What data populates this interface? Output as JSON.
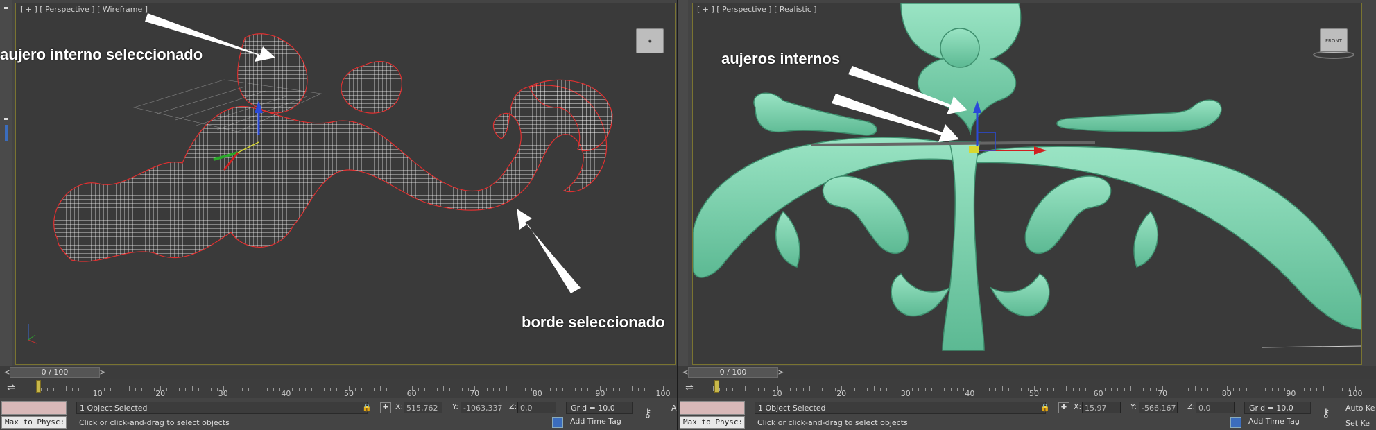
{
  "left": {
    "viewport_label": "[ + ] [ Perspective ] [ Wireframe ]",
    "annotations": {
      "top": "aujero interno seleccionado",
      "bottom": "borde seleccionado"
    },
    "scroll_thumb": "0 / 100",
    "timeline_labels": [
      "10",
      "20",
      "30",
      "40",
      "50",
      "60",
      "70",
      "80",
      "90",
      "100"
    ],
    "selected": "1 Object Selected",
    "prompt": "Click or click-and-drag to select objects",
    "x_label": "X:",
    "x": "515,762",
    "y_label": "Y:",
    "y": "-1063,337",
    "z_label": "Z:",
    "z": "0,0",
    "grid": "Grid = 10,0",
    "add_time_tag": "Add Time Tag",
    "maxscript": "Max to Physc:",
    "side_letter": "A"
  },
  "right": {
    "viewport_label": "[ + ] [ Perspective ] [ Realistic ]",
    "annotations": {
      "top": "aujeros internos"
    },
    "viewcube_label": "FRONT",
    "scroll_thumb": "0 / 100",
    "timeline_labels": [
      "10",
      "20",
      "30",
      "40",
      "50",
      "60",
      "70",
      "80",
      "90",
      "100"
    ],
    "selected": "1 Object Selected",
    "prompt": "Click or click-and-drag to select objects",
    "x_label": "X:",
    "x": "15,97",
    "y_label": "Y:",
    "y": "-566,167",
    "z_label": "Z:",
    "z": "0,0",
    "grid": "Grid = 10,0",
    "add_time_tag": "Add Time Tag",
    "maxscript": "Max to Physc:",
    "auto_key": "Auto Ke",
    "set_key": "Set Ke"
  },
  "colors": {
    "mesh_green": "#7fd3ae",
    "selection_red": "#e03030",
    "viewport_border": "#7a7431"
  }
}
